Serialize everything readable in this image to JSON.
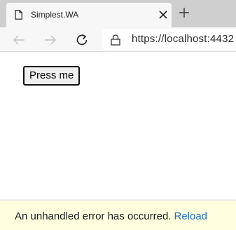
{
  "browser": {
    "tab": {
      "title": "Simplest.WA",
      "favicon": "page-icon",
      "close_icon": "close-icon"
    },
    "new_tab_icon": "plus-icon",
    "toolbar": {
      "back_icon": "arrow-left-icon",
      "forward_icon": "arrow-right-icon",
      "refresh_icon": "refresh-icon",
      "lock_icon": "lock-icon",
      "url": "https://localhost:4432"
    }
  },
  "page": {
    "button_label": "Press me"
  },
  "error_bar": {
    "message": "An unhandled error has occurred.",
    "reload_label": "Reload",
    "background_color": "#ffffe0",
    "link_color": "#1a6dc4"
  }
}
